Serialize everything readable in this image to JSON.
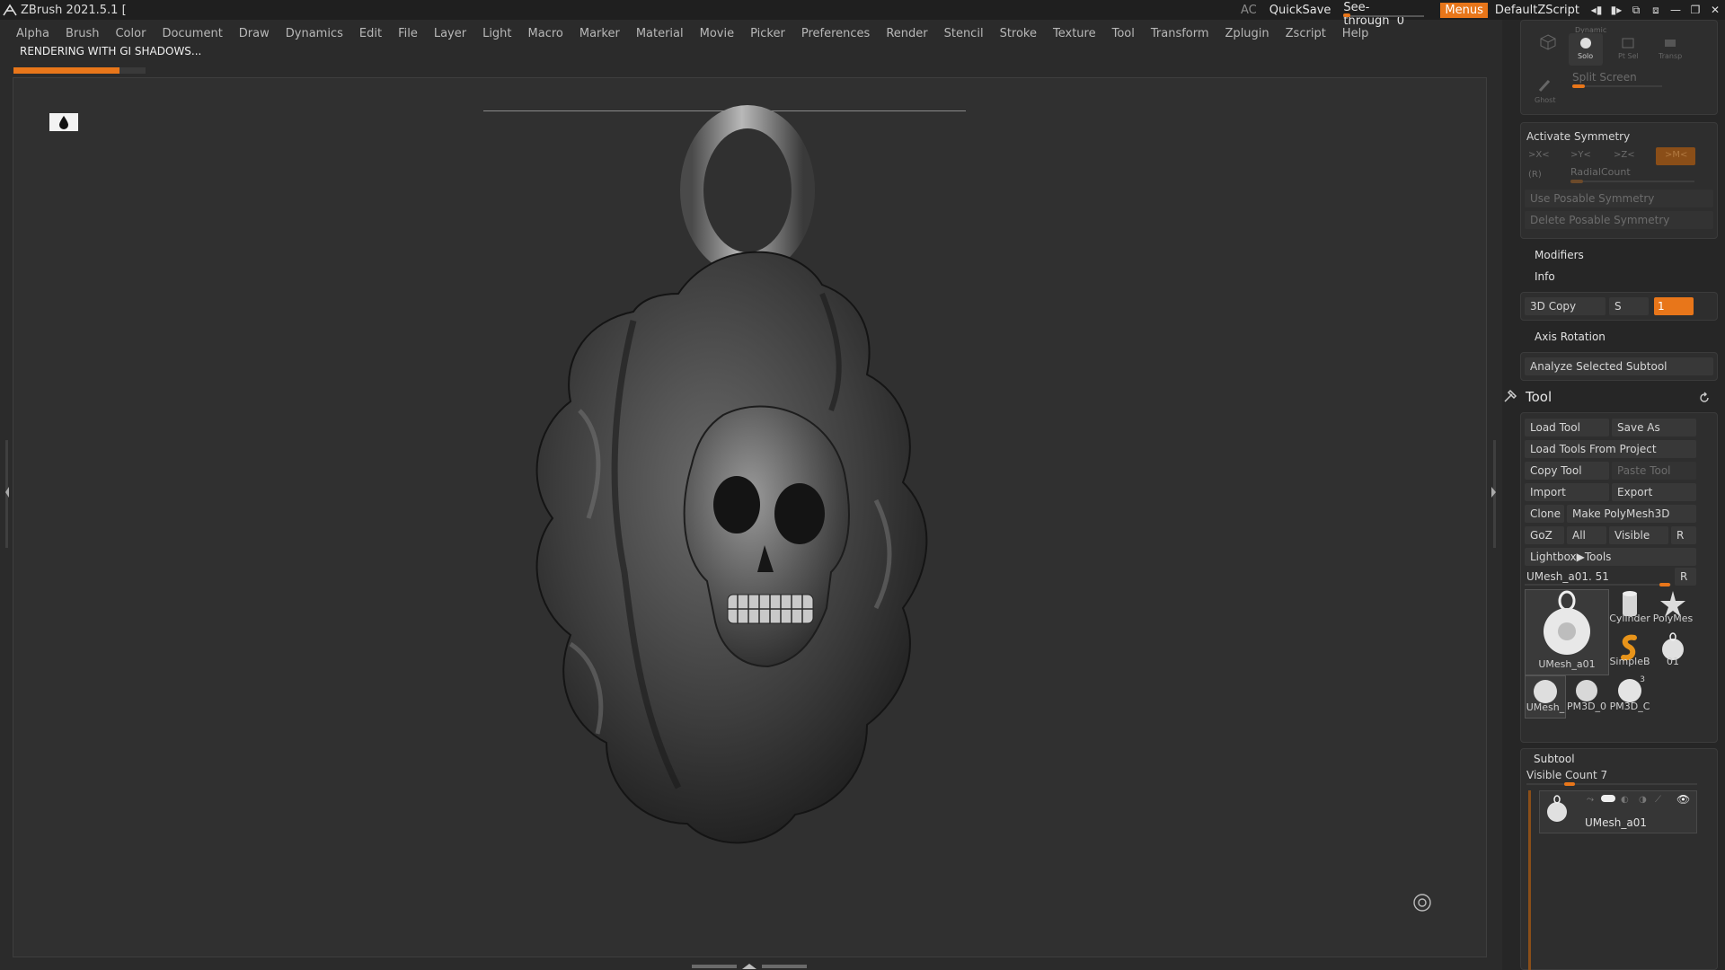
{
  "app": {
    "title": "ZBrush 2021.5.1 [",
    "ac_label": "AC",
    "quicksave_label": "QuickSave",
    "seethrough_label": "See-through",
    "seethrough_value": "0",
    "menus_label": "Menus",
    "script_label": "DefaultZScript"
  },
  "menu": [
    "Alpha",
    "Brush",
    "Color",
    "Document",
    "Draw",
    "Dynamics",
    "Edit",
    "File",
    "Layer",
    "Light",
    "Macro",
    "Marker",
    "Material",
    "Movie",
    "Picker",
    "Preferences",
    "Render",
    "Stencil",
    "Stroke",
    "Texture",
    "Tool",
    "Transform",
    "Zplugin",
    "Zscript",
    "Help"
  ],
  "status": {
    "render_text": "RENDERING WITH GI SHADOWS...",
    "progress_fraction": 0.8
  },
  "colors": {
    "accent": "#e8761a",
    "panel": "#2e2e2e",
    "button": "#383838"
  },
  "top_group": {
    "dynamic_label": "Dynamic",
    "solo_label": "Solo",
    "ptsel_label": "Pt Sel",
    "transp_label": "Transp",
    "ghost_label": "Ghost",
    "split_screen_label": "Split Screen"
  },
  "symmetry": {
    "activate_label": "Activate Symmetry",
    "x_label": ">X<",
    "y_label": ">Y<",
    "z_label": ">Z<",
    "m_label": ">M<",
    "r_label": "(R)",
    "radial_label": "RadialCount",
    "posable_label": "Use Posable Symmetry",
    "delete_posable_label": "Delete Posable Symmetry"
  },
  "modifiers_label": "Modifiers",
  "info_label": "Info",
  "copy3d": {
    "label": "3D Copy",
    "s_label": "S",
    "value": "1"
  },
  "axis_rotation_label": "Axis Rotation",
  "analyze_label": "Analyze Selected Subtool",
  "tool": {
    "title": "Tool",
    "load_tool": "Load Tool",
    "save_as": "Save As",
    "load_from_project": "Load Tools From Project",
    "copy_tool": "Copy Tool",
    "paste_tool": "Paste Tool",
    "import": "Import",
    "export": "Export",
    "clone": "Clone",
    "make_polymesh": "Make PolyMesh3D",
    "goz": "GoZ",
    "all": "All",
    "visible": "Visible",
    "r": "R",
    "lightbox": "Lightbox▶Tools",
    "current_tool": "UMesh_a01. 51",
    "current_r": "R",
    "thumbs": {
      "main": "UMesh_a01",
      "cylinder": "Cylinder",
      "polymesh": "PolyMes",
      "simpleb": "SimpleB",
      "small": "01",
      "umesh_small": "UMesh_",
      "pm3d1": "PM3D_0",
      "pm3d2": "PM3D_C",
      "pm3d2_count": "3"
    }
  },
  "subtool": {
    "title": "Subtool",
    "visible_count": "Visible Count 7",
    "item_name": "UMesh_a01"
  }
}
